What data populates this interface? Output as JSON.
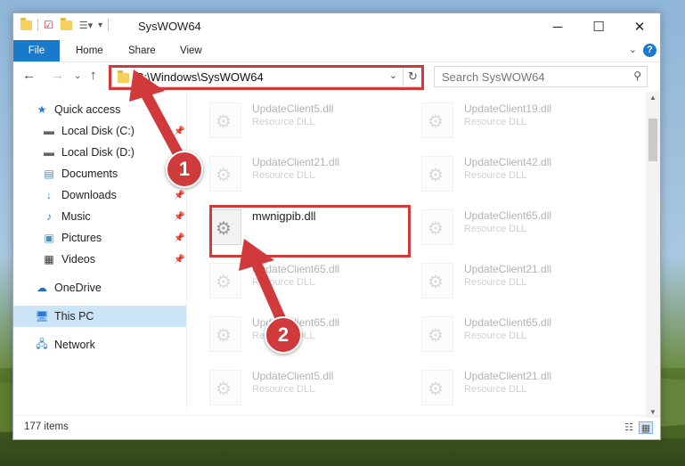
{
  "window": {
    "title": "SysWOW64",
    "controls": {
      "minimize": "─",
      "maximize": "☐",
      "close": "✕"
    }
  },
  "ribbon": {
    "tabs": [
      "File",
      "Home",
      "Share",
      "View"
    ],
    "help": "?"
  },
  "address": {
    "path": "C:\\Windows\\SysWOW64",
    "search_placeholder": "Search SysWOW64"
  },
  "nav": {
    "items": [
      {
        "label": "Quick access",
        "icon": "star-icon",
        "pinned": false
      },
      {
        "label": "Local Disk (C:)",
        "icon": "drive-icon",
        "pinned": true
      },
      {
        "label": "Local Disk (D:)",
        "icon": "drive-icon",
        "pinned": false
      },
      {
        "label": "Documents",
        "icon": "documents-icon",
        "pinned": true
      },
      {
        "label": "Downloads",
        "icon": "download-icon",
        "pinned": true
      },
      {
        "label": "Music",
        "icon": "music-icon",
        "pinned": true
      },
      {
        "label": "Pictures",
        "icon": "pictures-icon",
        "pinned": true
      },
      {
        "label": "Videos",
        "icon": "videos-icon",
        "pinned": true
      },
      {
        "label": "OneDrive",
        "icon": "cloud-icon",
        "pinned": false
      },
      {
        "label": "This PC",
        "icon": "computer-icon",
        "pinned": false,
        "selected": true
      },
      {
        "label": "Network",
        "icon": "network-icon",
        "pinned": false
      }
    ]
  },
  "files": {
    "left": [
      {
        "name": "UpdateClient5.dll",
        "desc": "Resource DLL"
      },
      {
        "name": "UpdateClient21.dll",
        "desc": "Resource DLL"
      },
      {
        "name": "mwnigpib.dll",
        "desc": ""
      },
      {
        "name": "UpdateClient65.dll",
        "desc": "Resource DLL"
      },
      {
        "name": "UpdateClient65.dll",
        "desc": "Resource DLL"
      },
      {
        "name": "UpdateClient5.dll",
        "desc": "Resource DLL"
      }
    ],
    "right": [
      {
        "name": "UpdateClient19.dll",
        "desc": "Resource DLL"
      },
      {
        "name": "UpdateClient42.dll",
        "desc": "Resource DLL"
      },
      {
        "name": "UpdateClient65.dll",
        "desc": "Resource DLL"
      },
      {
        "name": "UpdateClient21.dll",
        "desc": "Resource DLL"
      },
      {
        "name": "UpdateClient65.dll",
        "desc": "Resource DLL"
      },
      {
        "name": "UpdateClient21.dll",
        "desc": "Resource DLL"
      }
    ]
  },
  "status": {
    "count": "177 items"
  },
  "annotations": {
    "step1": "1",
    "step2": "2"
  },
  "colors": {
    "accent": "#1979ca",
    "highlight": "#d03a3a",
    "selected": "#cce4f7"
  }
}
